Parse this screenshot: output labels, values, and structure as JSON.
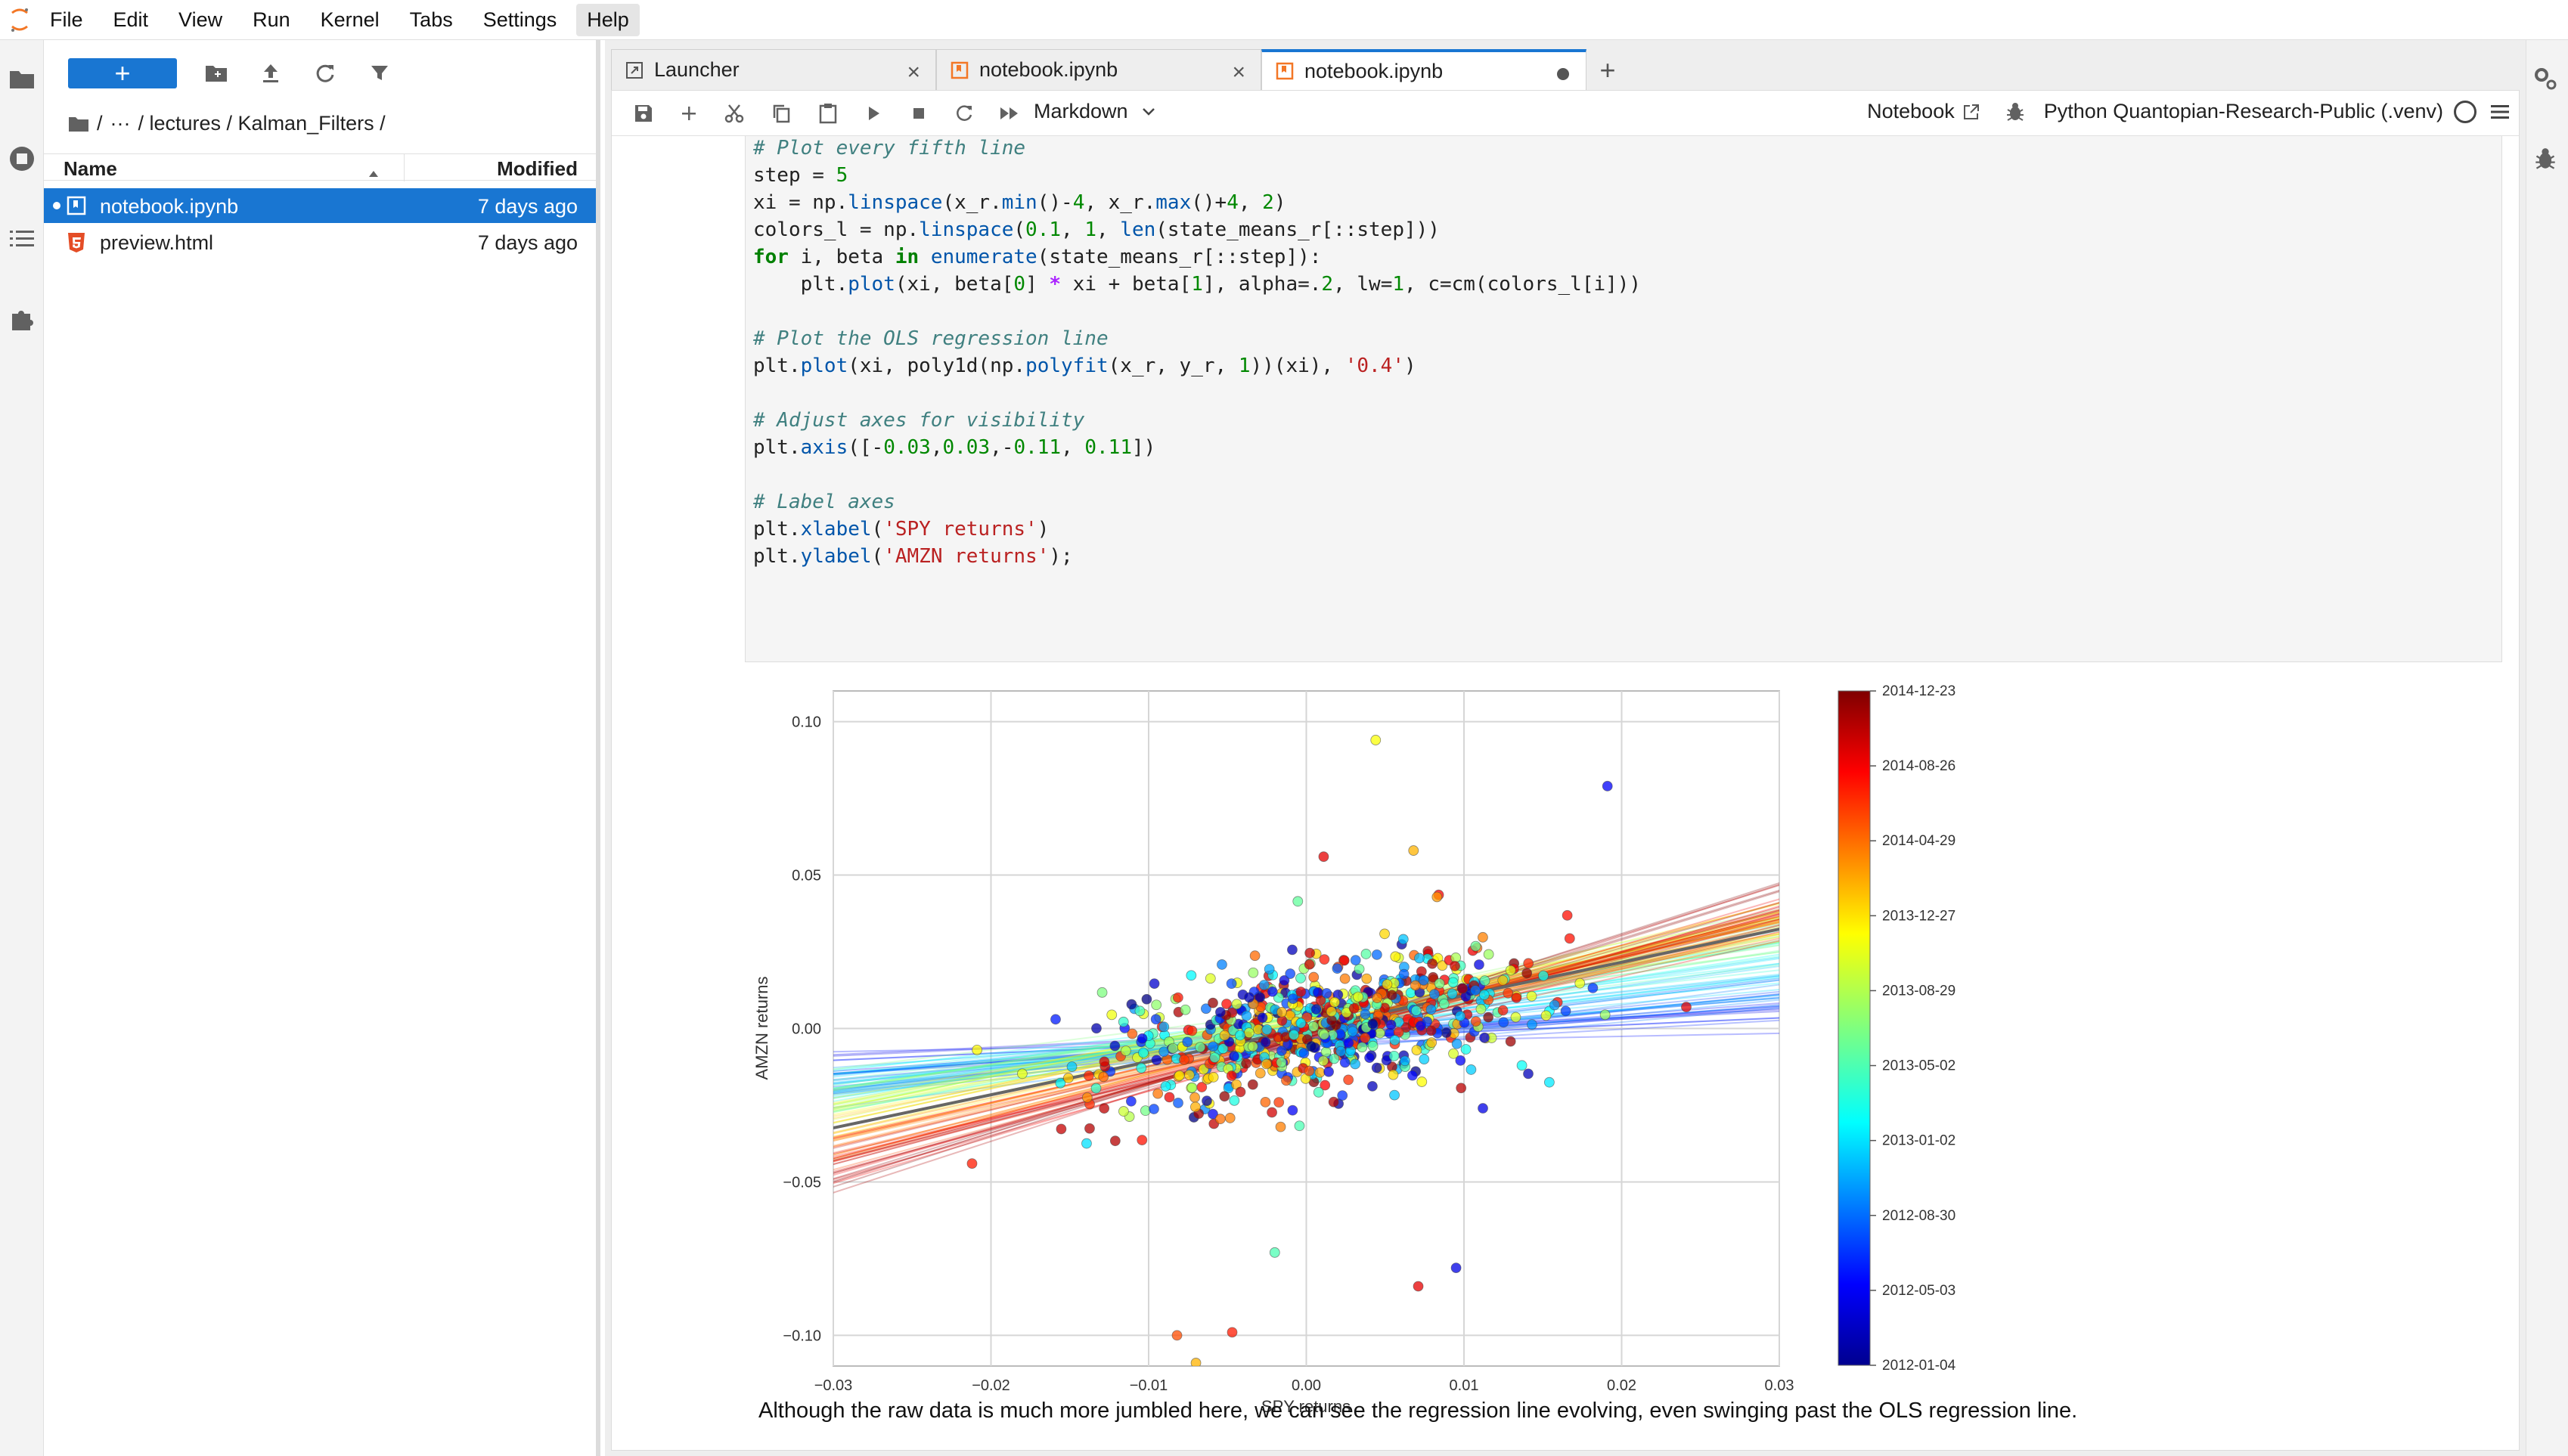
{
  "menubar": {
    "items": [
      "File",
      "Edit",
      "View",
      "Run",
      "Kernel",
      "Tabs",
      "Settings",
      "Help"
    ]
  },
  "filebrowser": {
    "new_label": "+",
    "breadcrumb": [
      "/",
      "···",
      "/ lectures / Kalman_Filters /"
    ],
    "col_name": "Name",
    "col_modified": "Modified",
    "files": [
      {
        "name": "notebook.ipynb",
        "modified": "7 days ago",
        "icon": "notebook-icon"
      },
      {
        "name": "preview.html",
        "modified": "7 days ago",
        "icon": "html5-icon"
      }
    ]
  },
  "tabs": [
    {
      "label": "Launcher"
    },
    {
      "label": "notebook.ipynb"
    },
    {
      "label": "notebook.ipynb"
    }
  ],
  "toolbar": {
    "cell_type": "Markdown",
    "notebook_label": "Notebook",
    "kernel_name": "Python Quantopian-Research-Public (.venv)"
  },
  "code_lines": [
    "# Plot every fifth line",
    "step = 5",
    "xi = np.linspace(x_r.min()-4, x_r.max()+4, 2)",
    "colors_l = np.linspace(0.1, 1, len(state_means_r[::step]))",
    "for i, beta in enumerate(state_means_r[::step]):",
    "    plt.plot(xi, beta[0] * xi + beta[1], alpha=.2, lw=1, c=cm(colors_l[i]))",
    "",
    "# Plot the OLS regression line",
    "plt.plot(xi, poly1d(np.polyfit(x_r, y_r, 1))(xi), '0.4')",
    "",
    "# Adjust axes for visibility",
    "plt.axis([-0.03,0.03,-0.11, 0.11])",
    "",
    "# Label axes",
    "plt.xlabel('SPY returns')",
    "plt.ylabel('AMZN returns');"
  ],
  "markdown_text": "Although the raw data is much more jumbled here, we can see the regression line evolving, even swinging past the OLS regression line.",
  "chart_data": {
    "type": "scatter",
    "title": "",
    "xlabel": "SPY returns",
    "ylabel": "AMZN returns",
    "xlim": [
      -0.03,
      0.03
    ],
    "ylim": [
      -0.11,
      0.11
    ],
    "x_ticks": [
      "−0.03",
      "−0.02",
      "−0.01",
      "0.00",
      "0.01",
      "0.02",
      "0.03"
    ],
    "y_ticks": [
      "0.10",
      "0.05",
      "0.00",
      "−0.05",
      "−0.10"
    ],
    "grid": true,
    "colormap": "jet",
    "colorbar_labels": [
      "2014-12-23",
      "2014-08-26",
      "2014-04-29",
      "2013-12-27",
      "2013-08-29",
      "2013-05-02",
      "2013-01-02",
      "2012-08-30",
      "2012-05-03",
      "2012-01-04"
    ],
    "ols_line": {
      "slope": 1.08,
      "intercept": 0.0
    },
    "outliers": [
      {
        "x": 0.0044,
        "y": 0.094,
        "c": 0.62
      },
      {
        "x": 0.0191,
        "y": 0.079,
        "c": 0.12
      },
      {
        "x": 0.0095,
        "y": -0.078,
        "c": 0.1
      },
      {
        "x": 0.0071,
        "y": -0.084,
        "c": 0.9
      },
      {
        "x": -0.002,
        "y": -0.073,
        "c": 0.45
      },
      {
        "x": -0.0047,
        "y": -0.099,
        "c": 0.85
      },
      {
        "x": -0.0082,
        "y": -0.1,
        "c": 0.8
      },
      {
        "x": -0.007,
        "y": -0.109,
        "c": 0.7
      },
      {
        "x": 0.0068,
        "y": 0.058,
        "c": 0.7
      },
      {
        "x": 0.0011,
        "y": 0.056,
        "c": 0.9
      },
      {
        "x": 0.0241,
        "y": 0.007,
        "c": 0.9
      },
      {
        "x": -0.0212,
        "y": -0.044,
        "c": 0.85
      },
      {
        "x": 0.0112,
        "y": -0.026,
        "c": 0.1
      },
      {
        "x": -0.0159,
        "y": 0.003,
        "c": 0.15
      }
    ]
  }
}
